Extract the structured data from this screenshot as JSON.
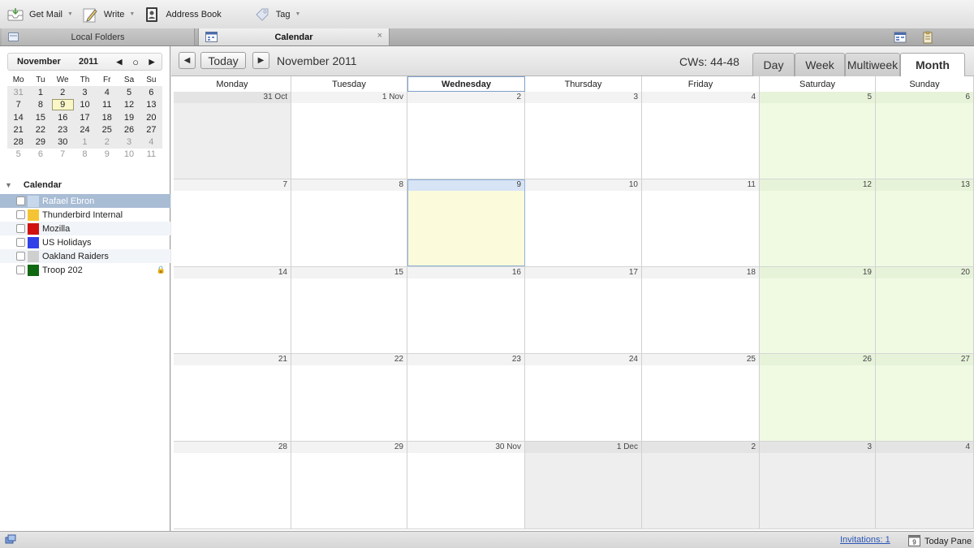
{
  "toolbar": {
    "get_mail": "Get Mail",
    "write": "Write",
    "address_book": "Address Book",
    "tag": "Tag"
  },
  "tabs": {
    "local_folders": "Local Folders",
    "calendar": "Calendar",
    "close_symbol": "×"
  },
  "minimonth": {
    "month": "November",
    "year": "2011",
    "prev": "◀",
    "today_symbol": "○",
    "next": "▶",
    "dow": [
      "Mo",
      "Tu",
      "We",
      "Th",
      "Fr",
      "Sa",
      "Su"
    ],
    "weeks": [
      [
        {
          "d": "31",
          "out": true
        },
        {
          "d": "1"
        },
        {
          "d": "2"
        },
        {
          "d": "3"
        },
        {
          "d": "4"
        },
        {
          "d": "5"
        },
        {
          "d": "6"
        }
      ],
      [
        {
          "d": "7"
        },
        {
          "d": "8"
        },
        {
          "d": "9",
          "today": true
        },
        {
          "d": "10"
        },
        {
          "d": "11"
        },
        {
          "d": "12"
        },
        {
          "d": "13"
        }
      ],
      [
        {
          "d": "14"
        },
        {
          "d": "15"
        },
        {
          "d": "16"
        },
        {
          "d": "17"
        },
        {
          "d": "18"
        },
        {
          "d": "19"
        },
        {
          "d": "20"
        }
      ],
      [
        {
          "d": "21"
        },
        {
          "d": "22"
        },
        {
          "d": "23"
        },
        {
          "d": "24"
        },
        {
          "d": "25"
        },
        {
          "d": "26"
        },
        {
          "d": "27"
        }
      ],
      [
        {
          "d": "28"
        },
        {
          "d": "29"
        },
        {
          "d": "30"
        },
        {
          "d": "1",
          "out": true
        },
        {
          "d": "2",
          "out": true
        },
        {
          "d": "3",
          "out": true
        },
        {
          "d": "4",
          "out": true
        }
      ],
      [
        {
          "d": "5",
          "out": true
        },
        {
          "d": "6",
          "out": true
        },
        {
          "d": "7",
          "out": true
        },
        {
          "d": "8",
          "out": true
        },
        {
          "d": "9",
          "out": true
        },
        {
          "d": "10",
          "out": true
        },
        {
          "d": "11",
          "out": true
        }
      ]
    ]
  },
  "calendars": {
    "title": "Calendar",
    "items": [
      {
        "name": "Rafael Ebron",
        "color": "#c8d8ec",
        "selected": true,
        "locked": false
      },
      {
        "name": "Thunderbird Internal",
        "color": "#f5c434",
        "selected": false,
        "locked": false
      },
      {
        "name": "Mozilla",
        "color": "#d11010",
        "selected": false,
        "locked": false
      },
      {
        "name": "US Holidays",
        "color": "#3240e8",
        "selected": false,
        "locked": false
      },
      {
        "name": "Oakland Raiders",
        "color": "#cfcfcf",
        "selected": false,
        "locked": false
      },
      {
        "name": "Troop 202",
        "color": "#106810",
        "selected": false,
        "locked": true
      }
    ]
  },
  "main": {
    "prev": "◀",
    "today": "Today",
    "next": "▶",
    "title": "November 2011",
    "cws": "CWs: 44-48",
    "views": [
      "Day",
      "Week",
      "Multiweek",
      "Month"
    ],
    "active_view": "Month",
    "dow": [
      "Monday",
      "Tuesday",
      "Wednesday",
      "Thursday",
      "Friday",
      "Saturday",
      "Sunday"
    ],
    "today_dow": "Wednesday",
    "weeks": [
      [
        {
          "l": "31 Oct",
          "t": "other-weekday"
        },
        {
          "l": "1 Nov"
        },
        {
          "l": "2"
        },
        {
          "l": "3"
        },
        {
          "l": "4"
        },
        {
          "l": "5",
          "t": "weekend"
        },
        {
          "l": "6",
          "t": "weekend"
        }
      ],
      [
        {
          "l": "7"
        },
        {
          "l": "8"
        },
        {
          "l": "9",
          "t": "today"
        },
        {
          "l": "10"
        },
        {
          "l": "11"
        },
        {
          "l": "12",
          "t": "weekend"
        },
        {
          "l": "13",
          "t": "weekend"
        }
      ],
      [
        {
          "l": "14"
        },
        {
          "l": "15"
        },
        {
          "l": "16"
        },
        {
          "l": "17"
        },
        {
          "l": "18"
        },
        {
          "l": "19",
          "t": "weekend"
        },
        {
          "l": "20",
          "t": "weekend"
        }
      ],
      [
        {
          "l": "21"
        },
        {
          "l": "22"
        },
        {
          "l": "23"
        },
        {
          "l": "24"
        },
        {
          "l": "25"
        },
        {
          "l": "26",
          "t": "weekend"
        },
        {
          "l": "27",
          "t": "weekend"
        }
      ],
      [
        {
          "l": "28"
        },
        {
          "l": "29"
        },
        {
          "l": "30 Nov"
        },
        {
          "l": "1 Dec",
          "t": "other"
        },
        {
          "l": "2",
          "t": "other"
        },
        {
          "l": "3",
          "t": "other"
        },
        {
          "l": "4",
          "t": "other"
        }
      ]
    ]
  },
  "status": {
    "invitations": "Invitations: 1",
    "today_pane": "Today Pane",
    "today_pane_day": "9"
  }
}
